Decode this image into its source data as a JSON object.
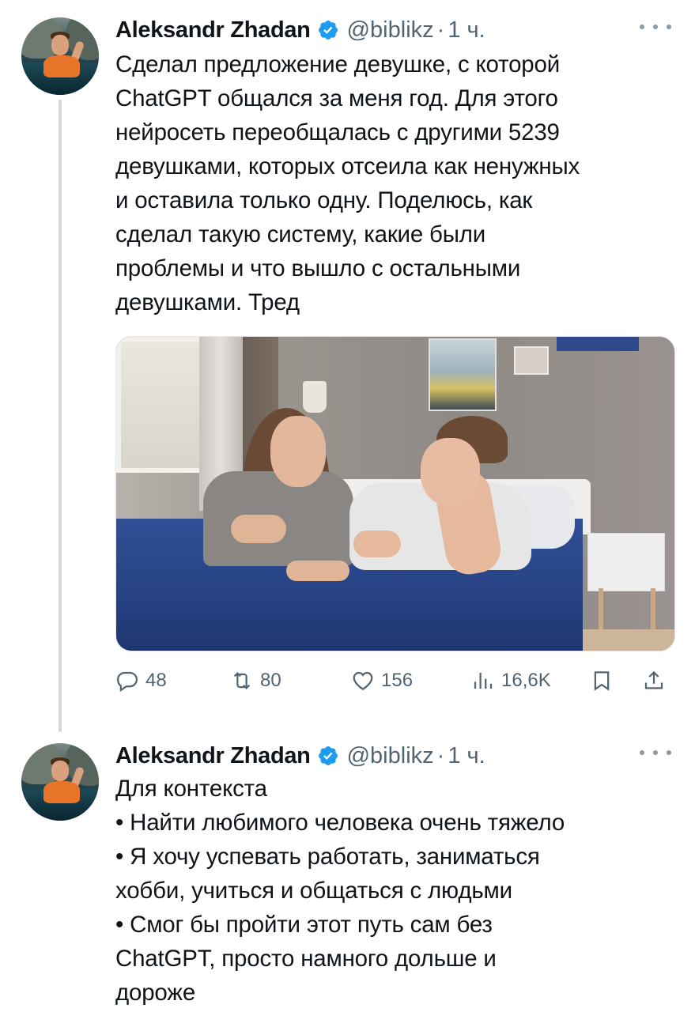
{
  "tweets": [
    {
      "author_name": "Aleksandr Zhadan",
      "handle": "@biblikz",
      "separator": "·",
      "time": "1 ч.",
      "text": "Сделал предложение девушке, с которой\nChatGPT общался за меня год. Для этого\nнейросеть переобщалась с другими 5239\nдевушками, которых отсеила как ненужных\nи оставила только одну. Поделюсь, как\nсделал такую систему, какие были\nпроблемы и что вышло с остальными\nдевушками. Тред",
      "actions": {
        "replies": "48",
        "retweets": "80",
        "likes": "156",
        "views": "16,6K"
      }
    },
    {
      "author_name": "Aleksandr Zhadan",
      "handle": "@biblikz",
      "separator": "·",
      "time": "1 ч.",
      "text": "Для контекста\n• Найти любимого человека очень тяжело\n• Я хочу успевать работать, заниматься\nхобби, учиться и общаться с людьми\n• Смог бы пройти этот путь сам без\nChatGPT, просто намного дольше и\nдороже"
    }
  ],
  "colors": {
    "verified": "#1d9bf0",
    "secondary_text": "#536471",
    "thread_line": "#cfd9de"
  },
  "icons": {
    "verified": "verified-badge-icon",
    "more": "more-options-icon",
    "reply": "reply-icon",
    "retweet": "retweet-icon",
    "like": "heart-icon",
    "views": "views-icon",
    "bookmark": "bookmark-icon",
    "share": "share-icon"
  }
}
